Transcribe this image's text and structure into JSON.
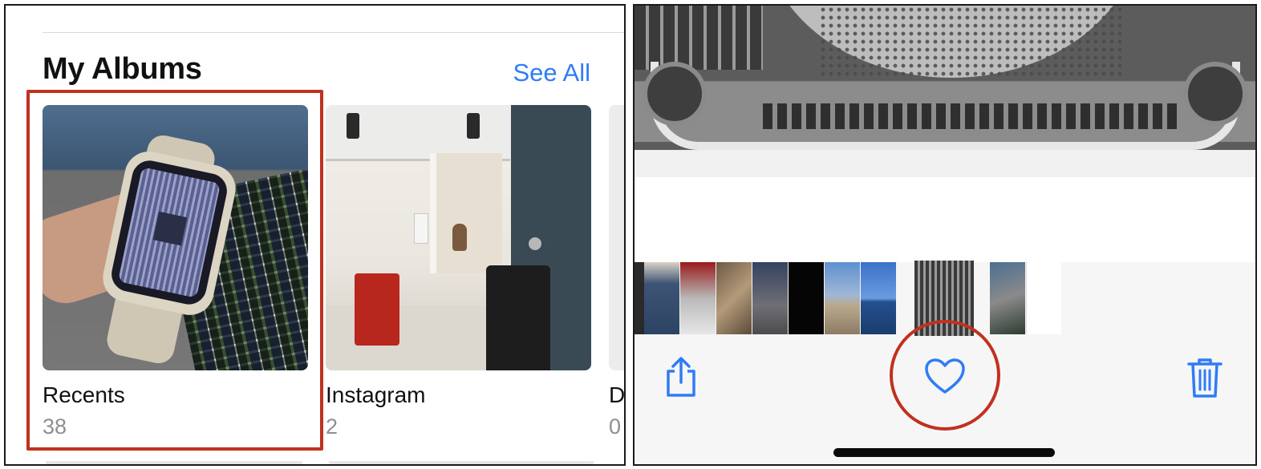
{
  "albums_screen": {
    "section_title": "My Albums",
    "see_all": "See All",
    "albums": [
      {
        "name": "Recents",
        "count": "38"
      },
      {
        "name": "Instagram",
        "count": "2"
      },
      {
        "name": "D",
        "count": "0"
      }
    ],
    "highlight_color": "#c1311f"
  },
  "photo_viewer": {
    "toolbar": {
      "share_icon": "share-icon",
      "favorite_icon": "heart-icon",
      "delete_icon": "trash-icon"
    },
    "filmstrip": {
      "frames": [
        "jeans",
        "car-logo",
        "cat",
        "phone",
        "black",
        "beach",
        "sea-sailboat",
        "xray-current",
        "watch",
        "albums-screenshot"
      ]
    },
    "accent_color": "#2f7cf6",
    "highlight_color": "#c1311f"
  }
}
